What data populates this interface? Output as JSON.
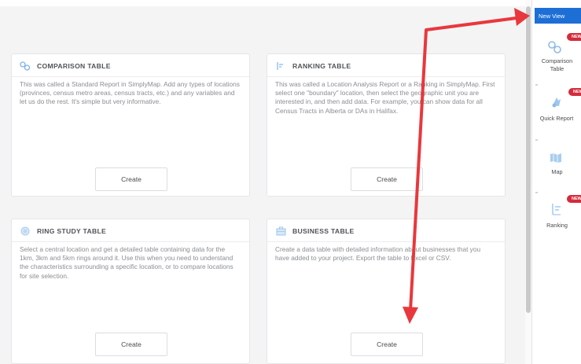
{
  "cards": [
    {
      "title": "COMPARISON TABLE",
      "icon": "comparison-icon",
      "description": "This was called a Standard Report in SimplyMap. Add any types of locations (provinces, census metro areas, census tracts, etc.) and any variables and let us do the rest. It's simple but very informative.",
      "button": "Create"
    },
    {
      "title": "RANKING TABLE",
      "icon": "ranking-icon",
      "description": "This was called a Location Analysis Report or a Ranking in SimplyMap. First select one \"boundary\" location, then select the geographic unit you are interested in, and then add data. For example, you can show data for all Census Tracts in Alberta or DAs in Halifax.",
      "button": "Create"
    },
    {
      "title": "RING STUDY TABLE",
      "icon": "ring-icon",
      "description": "Select a central location and get a detailed table containing data for the 1km, 3km and 5km rings around it. Use this when you need to understand the characteristics surrounding a specific location, or to compare locations for site selection.",
      "button": "Create"
    },
    {
      "title": "BUSINESS TABLE",
      "icon": "business-icon",
      "description": "Create a data table with detailed information about businesses that you have added to your project. Export the table to Excel or CSV.",
      "button": "Create"
    }
  ],
  "sidebar": {
    "new_view": "New View",
    "items": [
      {
        "label_line1": "Comparison",
        "label_line2": "Table",
        "badge": "NEW",
        "icon": "comparison-icon"
      },
      {
        "label_line1": "Quick Report",
        "label_line2": "",
        "badge": "NEW",
        "icon": "quick-report-icon"
      },
      {
        "label_line1": "Map",
        "label_line2": "",
        "badge": "",
        "icon": "map-icon"
      },
      {
        "label_line1": "Ranking",
        "label_line2": "",
        "badge": "NEW",
        "icon": "ranking-icon"
      }
    ]
  },
  "colors": {
    "accent": "#1d6fd6",
    "badge": "#d32c3c",
    "annotation_arrow": "#e8383d"
  }
}
